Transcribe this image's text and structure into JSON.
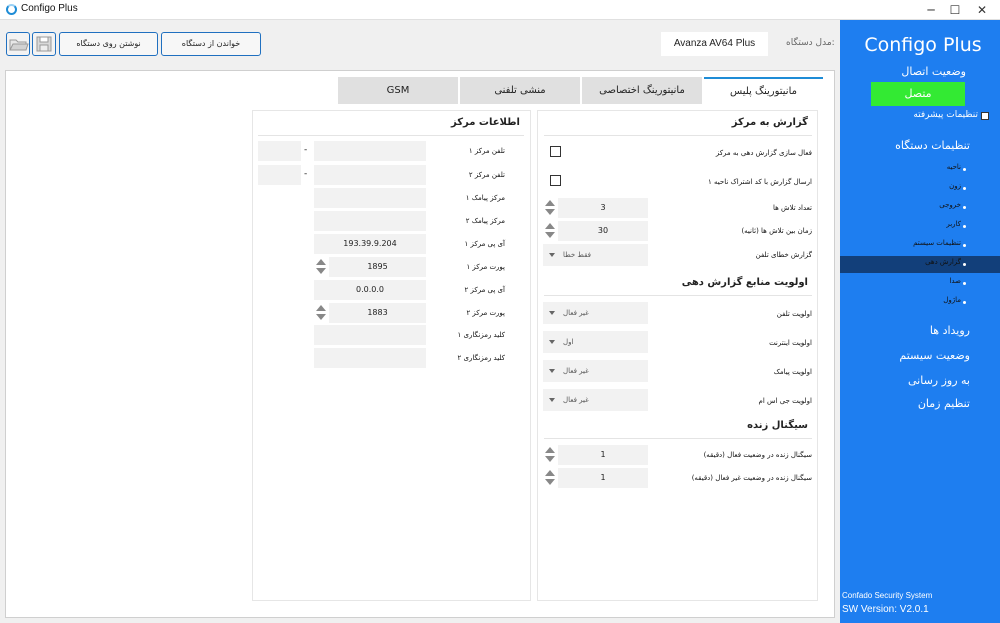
{
  "window": {
    "title": "Configo Plus",
    "minimize": "─",
    "maximize": "☐",
    "close": "✕"
  },
  "toolbar": {
    "read_label": "خواندن از دستگاه",
    "write_label": "نوشتن روی دستگاه",
    "device_model_label": "مدل دستگاه:",
    "device_model": "Avanza AV64 Plus"
  },
  "sidebar": {
    "brand": "Configo Plus",
    "connection_status_label": "وضعیت اتصال",
    "connect_button": "متصل",
    "advanced_settings": "تنظیمات پیشرفته",
    "device_settings": "تنظیمات دستگاه",
    "items": [
      {
        "label": "ناحیه"
      },
      {
        "label": "زون"
      },
      {
        "label": "خروجی"
      },
      {
        "label": "کاربر"
      },
      {
        "label": "تنظیمات سیستم"
      },
      {
        "label": "گزارش دهی"
      },
      {
        "label": "صدا"
      },
      {
        "label": "ماژول"
      }
    ],
    "sections": {
      "events": "رویداد ها",
      "system_status": "وضعیت سیستم",
      "update": "به روز رسانی",
      "time_settings": "تنظیم زمان"
    },
    "footer_company": "Confado Security System",
    "footer_version": "SW Version: V2.0.1"
  },
  "tabs": [
    "مانیتورینگ پلیس",
    "مانیتورینگ اختصاصی",
    "منشی تلفنی",
    "GSM"
  ],
  "report": {
    "title": "گزارش به مرکز",
    "enable_label": "فعال سازی گزارش دهی به مرکز",
    "send_area1_label": "ارسال گزارش با کد اشتراک ناحیه ۱",
    "call_count_label": "تعداد تلاش ها",
    "call_count": "3",
    "interval_label": "زمان بین تلاش ها (ثانیه)",
    "interval": "30",
    "line_error_label": "گزارش خطای تلفن",
    "line_error_value": "فقط خطا"
  },
  "priority": {
    "title": "اولویت منابع گزارش دهی",
    "phone_label": "اولویت تلفن",
    "phone_value": "غیر فعال",
    "internet_label": "اولویت اینترنت",
    "internet_value": "اول",
    "sms_label": "اولویت پیامک",
    "sms_value": "غیر فعال",
    "gsm_label": "اولویت جی اس ام",
    "gsm_value": "غیر فعال"
  },
  "heartbeat": {
    "title": "سیگنال زنده",
    "active_label": "سیگنال زنده در وضعیت فعال (دقیقه)",
    "active_value": "1",
    "inactive_label": "سیگنال زنده در وضعیت غیر فعال (دقیقه)",
    "inactive_value": "1"
  },
  "center": {
    "title": "اطلاعات مرکز",
    "phone1_label": "تلفن مرکز ۱",
    "phone2_label": "تلفن مرکز ۲",
    "sms1_label": "مرکز پیامک ۱",
    "sms2_label": "مرکز پیامک ۲",
    "ip1_label": "آی پی مرکز ۱",
    "ip1_value": "193.39.9.204",
    "port1_label": "پورت مرکز ۱",
    "port1_value": "1895",
    "ip2_label": "آی پی مرکز ۲",
    "ip2_value": "0.0.0.0",
    "port2_label": "پورت مرکز ۲",
    "port2_value": "1883",
    "key1_label": "کلید رمزنگاری ۱",
    "key2_label": "کلید رمزنگاری ۲",
    "dash": "-"
  }
}
